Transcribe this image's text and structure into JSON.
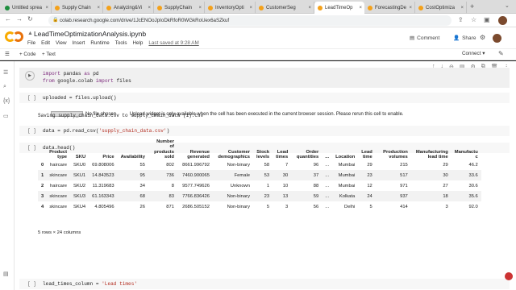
{
  "browser": {
    "tabs": [
      {
        "label": "Untitled sprea"
      },
      {
        "label": "Supply Chain"
      },
      {
        "label": "Analyzing&Vi"
      },
      {
        "label": "SupplyChain"
      },
      {
        "label": "InventoryOpti"
      },
      {
        "label": "CustomerSeg"
      },
      {
        "label": "LeadTimeOp"
      },
      {
        "label": "ForecastingDe"
      },
      {
        "label": "CostOptimiza"
      }
    ],
    "url": "colab.research.google.com/drive/1JcENOoJpIoDkRfoR0WGkRoUex6aSZkuf"
  },
  "colab": {
    "notebook_title": "LeadTimeOptimizationAnalysis.ipynb",
    "menu": [
      "File",
      "Edit",
      "View",
      "Insert",
      "Runtime",
      "Tools",
      "Help"
    ],
    "saved_note": "Last saved at 9:28 AM",
    "comment_label": "Comment",
    "share_label": "Share",
    "toolbar": {
      "add_code": "+ Code",
      "add_text": "+ Text",
      "connect": "Connect"
    }
  },
  "cells": {
    "c1_line1": "import pandas as pd",
    "c1_line2": "from google.colab import files",
    "c2_code": "uploaded = files.upload()",
    "c2_btn_label": "Choose Files",
    "c2_no_file": "No file chosen",
    "c2_warning": "Upload widget is only available when the cell has been executed in the current browser session. Please rerun this cell to enable.",
    "c2_saving": "Saving supply_chain_data.csv to supply_chain_data (1).csv",
    "c3_code": "data = pd.read_csv('supply_chain_data.csv')",
    "c4_code": "data.head()",
    "c5_code": "lead_times_column = 'Lead times'"
  },
  "dataframe": {
    "columns": [
      "",
      "Product type",
      "SKU",
      "Price",
      "Availability",
      "Number of products sold",
      "Revenue generated",
      "Customer demographics",
      "Stock levels",
      "Lead times",
      "Order quantities",
      "...",
      "Location",
      "Lead time",
      "Production volumes",
      "Manufacturing lead time",
      "Manufactu c"
    ],
    "rows": [
      [
        "0",
        "haircare",
        "SKU0",
        "69.808006",
        "55",
        "802",
        "8661.996792",
        "Non-binary",
        "58",
        "7",
        "96",
        "...",
        "Mumbai",
        "29",
        "215",
        "29",
        "46.2"
      ],
      [
        "1",
        "skincare",
        "SKU1",
        "14.843523",
        "95",
        "736",
        "7460.900065",
        "Female",
        "53",
        "30",
        "37",
        "...",
        "Mumbai",
        "23",
        "517",
        "30",
        "33.6"
      ],
      [
        "2",
        "haircare",
        "SKU2",
        "11.319683",
        "34",
        "8",
        "9577.749626",
        "Unknown",
        "1",
        "10",
        "88",
        "...",
        "Mumbai",
        "12",
        "971",
        "27",
        "30.6"
      ],
      [
        "3",
        "skincare",
        "SKU3",
        "61.163343",
        "68",
        "83",
        "7766.836426",
        "Non-binary",
        "23",
        "13",
        "59",
        "...",
        "Kolkata",
        "24",
        "937",
        "18",
        "35.6"
      ],
      [
        "4",
        "skincare",
        "SKU4",
        "4.805496",
        "26",
        "871",
        "2686.505152",
        "Non-binary",
        "5",
        "3",
        "56",
        "...",
        "Delhi",
        "5",
        "414",
        "3",
        "92.0"
      ]
    ],
    "shape_note": "5 rows × 24 columns"
  }
}
